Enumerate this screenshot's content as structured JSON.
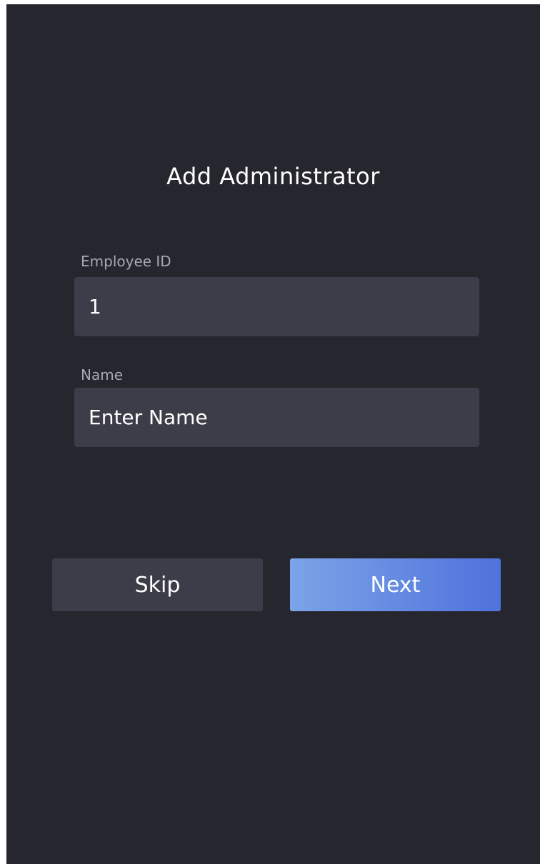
{
  "page": {
    "title": "Add Administrator"
  },
  "form": {
    "employee_id": {
      "label": "Employee ID",
      "value": "1"
    },
    "name": {
      "label": "Name",
      "placeholder": "Enter Name",
      "value": ""
    }
  },
  "actions": {
    "skip_label": "Skip",
    "next_label": "Next"
  },
  "colors": {
    "background": "#25262e",
    "field": "#3d3d4a",
    "accent_start": "#7ba4e8",
    "accent_end": "#4f72dc"
  }
}
